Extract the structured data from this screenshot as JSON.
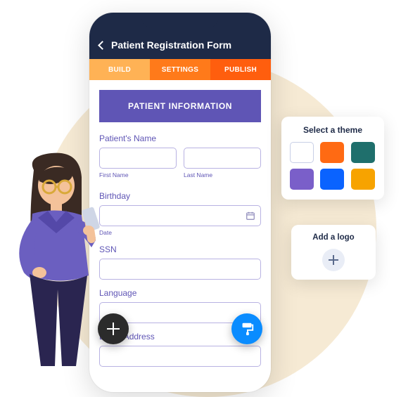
{
  "header": {
    "title": "Patient Registration Form"
  },
  "tabs": {
    "build": "BUILD",
    "settings": "SETTINGS",
    "publish": "PUBLISH"
  },
  "form": {
    "section_title": "PATIENT INFORMATION",
    "name_label": "Patient's Name",
    "first_name_sub": "First Name",
    "last_name_sub": "Last Name",
    "birthday_label": "Birthday",
    "date_sub": "Date",
    "ssn_label": "SSN",
    "language_label": "Language",
    "billing_label": "Billing Address"
  },
  "theme_panel": {
    "title": "Select a theme",
    "swatches": [
      "#ffffff",
      "#ff6a13",
      "#1f6f6c",
      "#7a5fc9",
      "#0a63ff",
      "#f7a300"
    ]
  },
  "logo_panel": {
    "title": "Add a logo"
  }
}
